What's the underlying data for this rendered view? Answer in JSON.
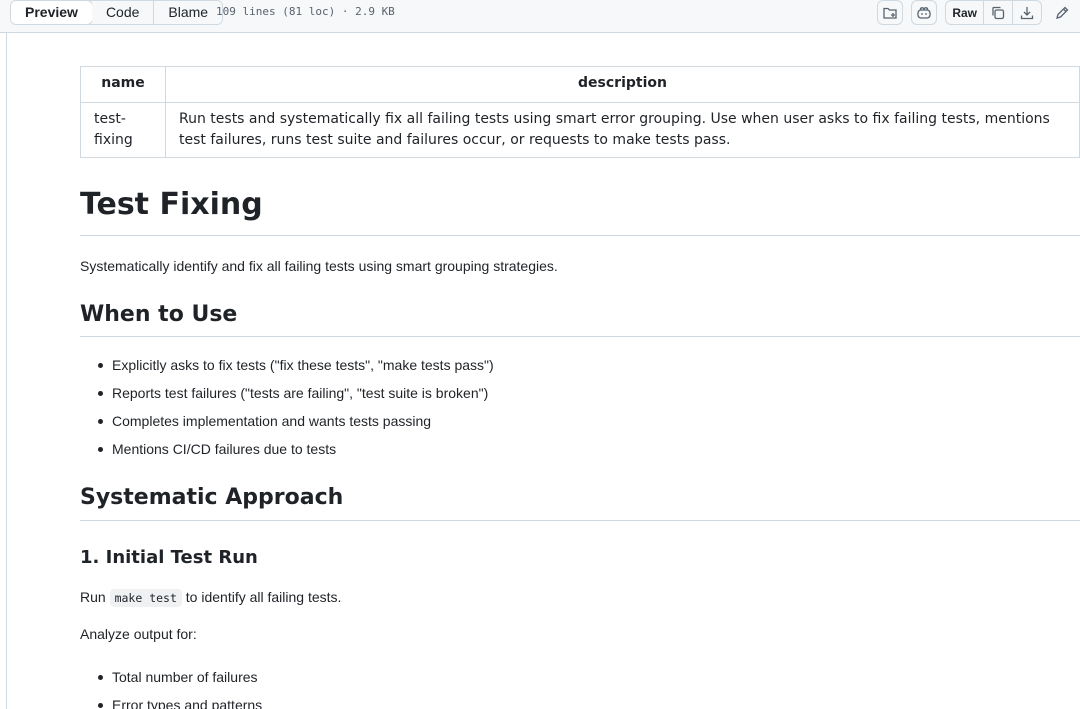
{
  "toolbar": {
    "tabs": [
      "Preview",
      "Code",
      "Blame"
    ],
    "file_meta": "109 lines (81 loc) · 2.9 KB",
    "raw_label": "Raw",
    "icons": [
      "add-to-directory-icon",
      "copilot-icon",
      "copy-icon",
      "download-icon",
      "edit-pencil-icon"
    ]
  },
  "table": {
    "headers": [
      "name",
      "description"
    ],
    "rows": [
      {
        "name": "test-fixing",
        "description": "Run tests and systematically fix all failing tests using smart error grouping. Use when user asks to fix failing tests, mentions test failures, runs test suite and failures occur, or requests to make tests pass."
      }
    ]
  },
  "doc": {
    "title": "Test Fixing",
    "intro": "Systematically identify and fix all failing tests using smart grouping strategies.",
    "section1": {
      "heading": "When to Use",
      "items": [
        "Explicitly asks to fix tests (\"fix these tests\", \"make tests pass\")",
        "Reports test failures (\"tests are failing\", \"test suite is broken\")",
        "Completes implementation and wants tests passing",
        "Mentions CI/CD failures due to tests"
      ]
    },
    "section2": {
      "heading": "Systematic Approach",
      "sub1": {
        "heading": "1. Initial Test Run",
        "run_prefix": "Run",
        "run_code": "make test",
        "run_suffix": "to identify all failing tests.",
        "analyze": "Analyze output for:",
        "items": [
          "Total number of failures",
          "Error types and patterns"
        ]
      }
    }
  }
}
